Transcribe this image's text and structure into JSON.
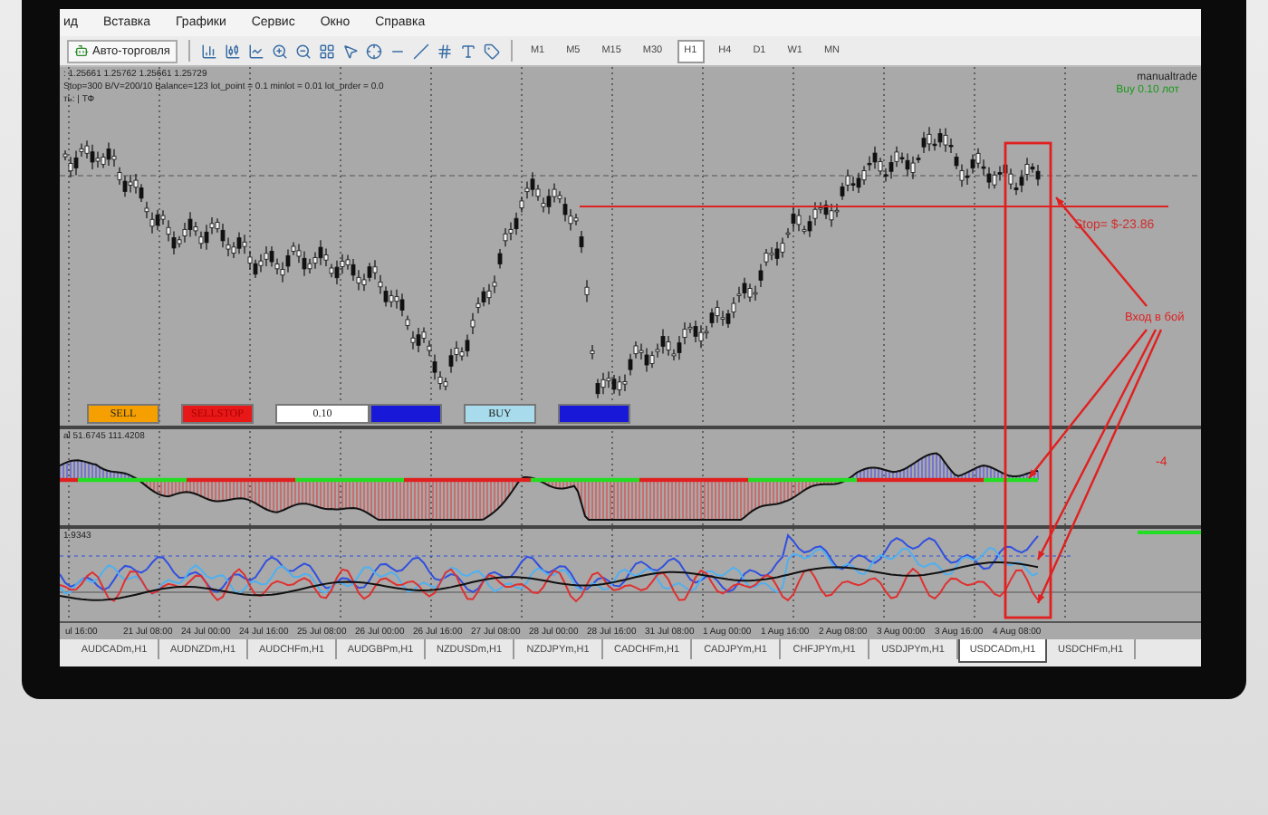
{
  "menu": [
    {
      "label": "ид"
    },
    {
      "label": "Вставка"
    },
    {
      "label": "Графики"
    },
    {
      "label": "Сервис"
    },
    {
      "label": "Окно"
    },
    {
      "label": "Справка"
    }
  ],
  "toolbar": {
    "auto_trading": {
      "label": "Авто-торговля"
    },
    "timeframes": [
      {
        "label": "M1",
        "selected": false
      },
      {
        "label": "M5",
        "selected": false
      },
      {
        "label": "M15",
        "selected": false
      },
      {
        "label": "M30",
        "selected": false
      },
      {
        "label": "H1",
        "selected": true
      },
      {
        "label": "H4",
        "selected": false
      },
      {
        "label": "D1",
        "selected": false
      },
      {
        "label": "W1",
        "selected": false
      },
      {
        "label": "MN",
        "selected": false
      }
    ]
  },
  "chart": {
    "info_lines": [
      ": 1.25661 1.25762 1.25661 1.25729",
      "Stop=300 B/V=200/10 Balance=123 lot_point = 0.1 minlot = 0.01 lot_order = 0.0",
      "ть: | ТФ"
    ],
    "ea_name": "manualtrade",
    "position_text": "Buy 0.10 лот",
    "stop_text": "Stop= $-23.86",
    "annotation": "Вход в бой",
    "indicator_1_label": "al 51.6745 111.4208",
    "indicator_1_value": "-4",
    "indicator_2_label": "1.9343",
    "trade_panel": [
      {
        "kind": "sell",
        "label": "SELL"
      },
      {
        "kind": "sellstop",
        "label": "SELLSTOP"
      },
      {
        "kind": "lot",
        "label": "0.10"
      },
      {
        "kind": "blank"
      },
      {
        "kind": "buy",
        "label": "BUY"
      },
      {
        "kind": "blank"
      }
    ]
  },
  "time_axis": [
    "ul 16:00",
    "21 Jul 08:00",
    "24 Jul 00:00",
    "24 Jul 16:00",
    "25 Jul 08:00",
    "26 Jul 00:00",
    "26 Jul 16:00",
    "27 Jul 08:00",
    "28 Jul 00:00",
    "28 Jul 16:00",
    "31 Jul 08:00",
    "1 Aug 00:00",
    "1 Aug 16:00",
    "2 Aug 08:00",
    "3 Aug 00:00",
    "3 Aug 16:00",
    "4 Aug 08:00"
  ],
  "tabs": [
    {
      "label": "AUDCADm,H1",
      "selected": false
    },
    {
      "label": "AUDNZDm,H1",
      "selected": false
    },
    {
      "label": "AUDCHFm,H1",
      "selected": false
    },
    {
      "label": "AUDGBPm,H1",
      "selected": false
    },
    {
      "label": "NZDUSDm,H1",
      "selected": false
    },
    {
      "label": "NZDJPYm,H1",
      "selected": false
    },
    {
      "label": "CADCHFm,H1",
      "selected": false
    },
    {
      "label": "CADJPYm,H1",
      "selected": false
    },
    {
      "label": "CHFJPYm,H1",
      "selected": false
    },
    {
      "label": "USDJPYm,H1",
      "selected": false
    },
    {
      "label": "USDCADm,H1",
      "selected": true
    },
    {
      "label": "USDCHFm,H1",
      "selected": false
    }
  ]
}
